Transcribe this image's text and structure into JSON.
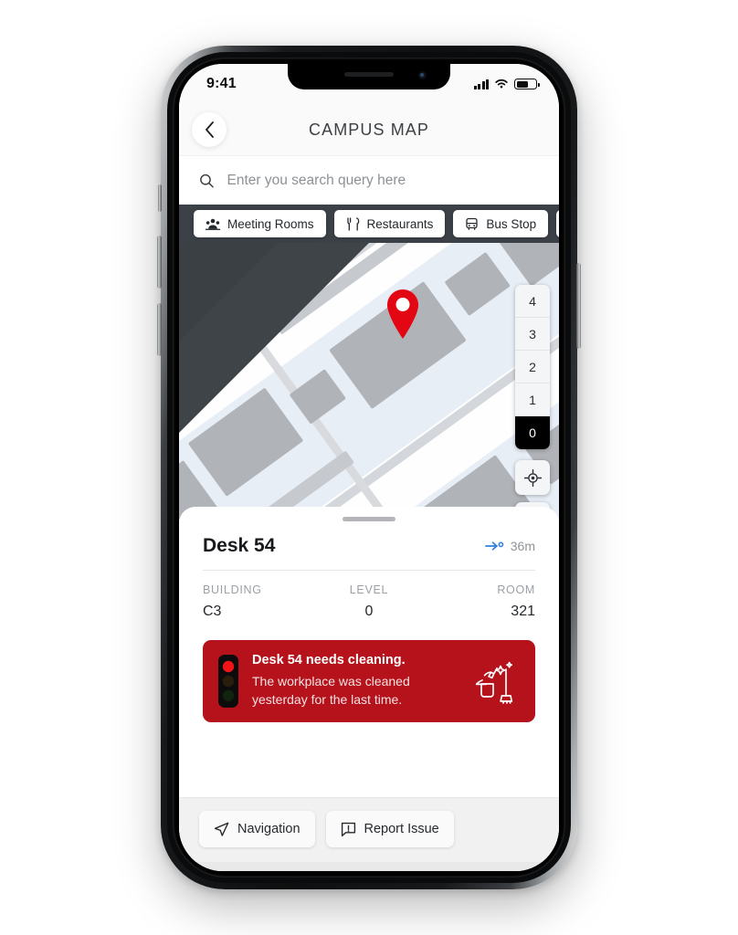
{
  "status_bar": {
    "time": "9:41",
    "signal_icon": "cellular-signal-icon",
    "wifi_icon": "wifi-icon",
    "battery_icon": "battery-icon",
    "battery_level": 60
  },
  "header": {
    "title": "CAMPUS MAP",
    "back_icon": "chevron-left-icon"
  },
  "search": {
    "placeholder": "Enter you search query here",
    "value": "",
    "icon": "search-icon"
  },
  "filters": [
    {
      "label": "Meeting Rooms",
      "icon": "people-group-icon"
    },
    {
      "label": "Restaurants",
      "icon": "fork-knife-icon"
    },
    {
      "label": "Bus Stop",
      "icon": "bus-icon"
    },
    {
      "label": "",
      "icon": "bus-icon"
    }
  ],
  "map": {
    "pin_icon": "map-pin-icon",
    "pin_color": "#e30613",
    "locate_icon": "crosshair-locate-icon",
    "floors": [
      "4",
      "3",
      "2",
      "1",
      "0"
    ],
    "active_floor": "0"
  },
  "sheet": {
    "grabber": "drag-handle",
    "place_name": "Desk 54",
    "distance": "36m",
    "distance_icon": "route-arrow-icon",
    "meta": [
      {
        "label": "BUILDING",
        "value": "C3"
      },
      {
        "label": "LEVEL",
        "value": "0"
      },
      {
        "label": "ROOM",
        "value": "321"
      }
    ],
    "alert": {
      "title": "Desk 54 needs cleaning.",
      "body": "The workplace was cleaned yesterday  for the last time.",
      "color": "#b5121b",
      "status_icon": "traffic-light-icon",
      "illustration_icon": "cleaning-supplies-icon"
    },
    "actions": [
      {
        "label": "Navigation",
        "icon": "navigation-arrow-icon"
      },
      {
        "label": "Report Issue",
        "icon": "report-issue-icon"
      }
    ]
  }
}
